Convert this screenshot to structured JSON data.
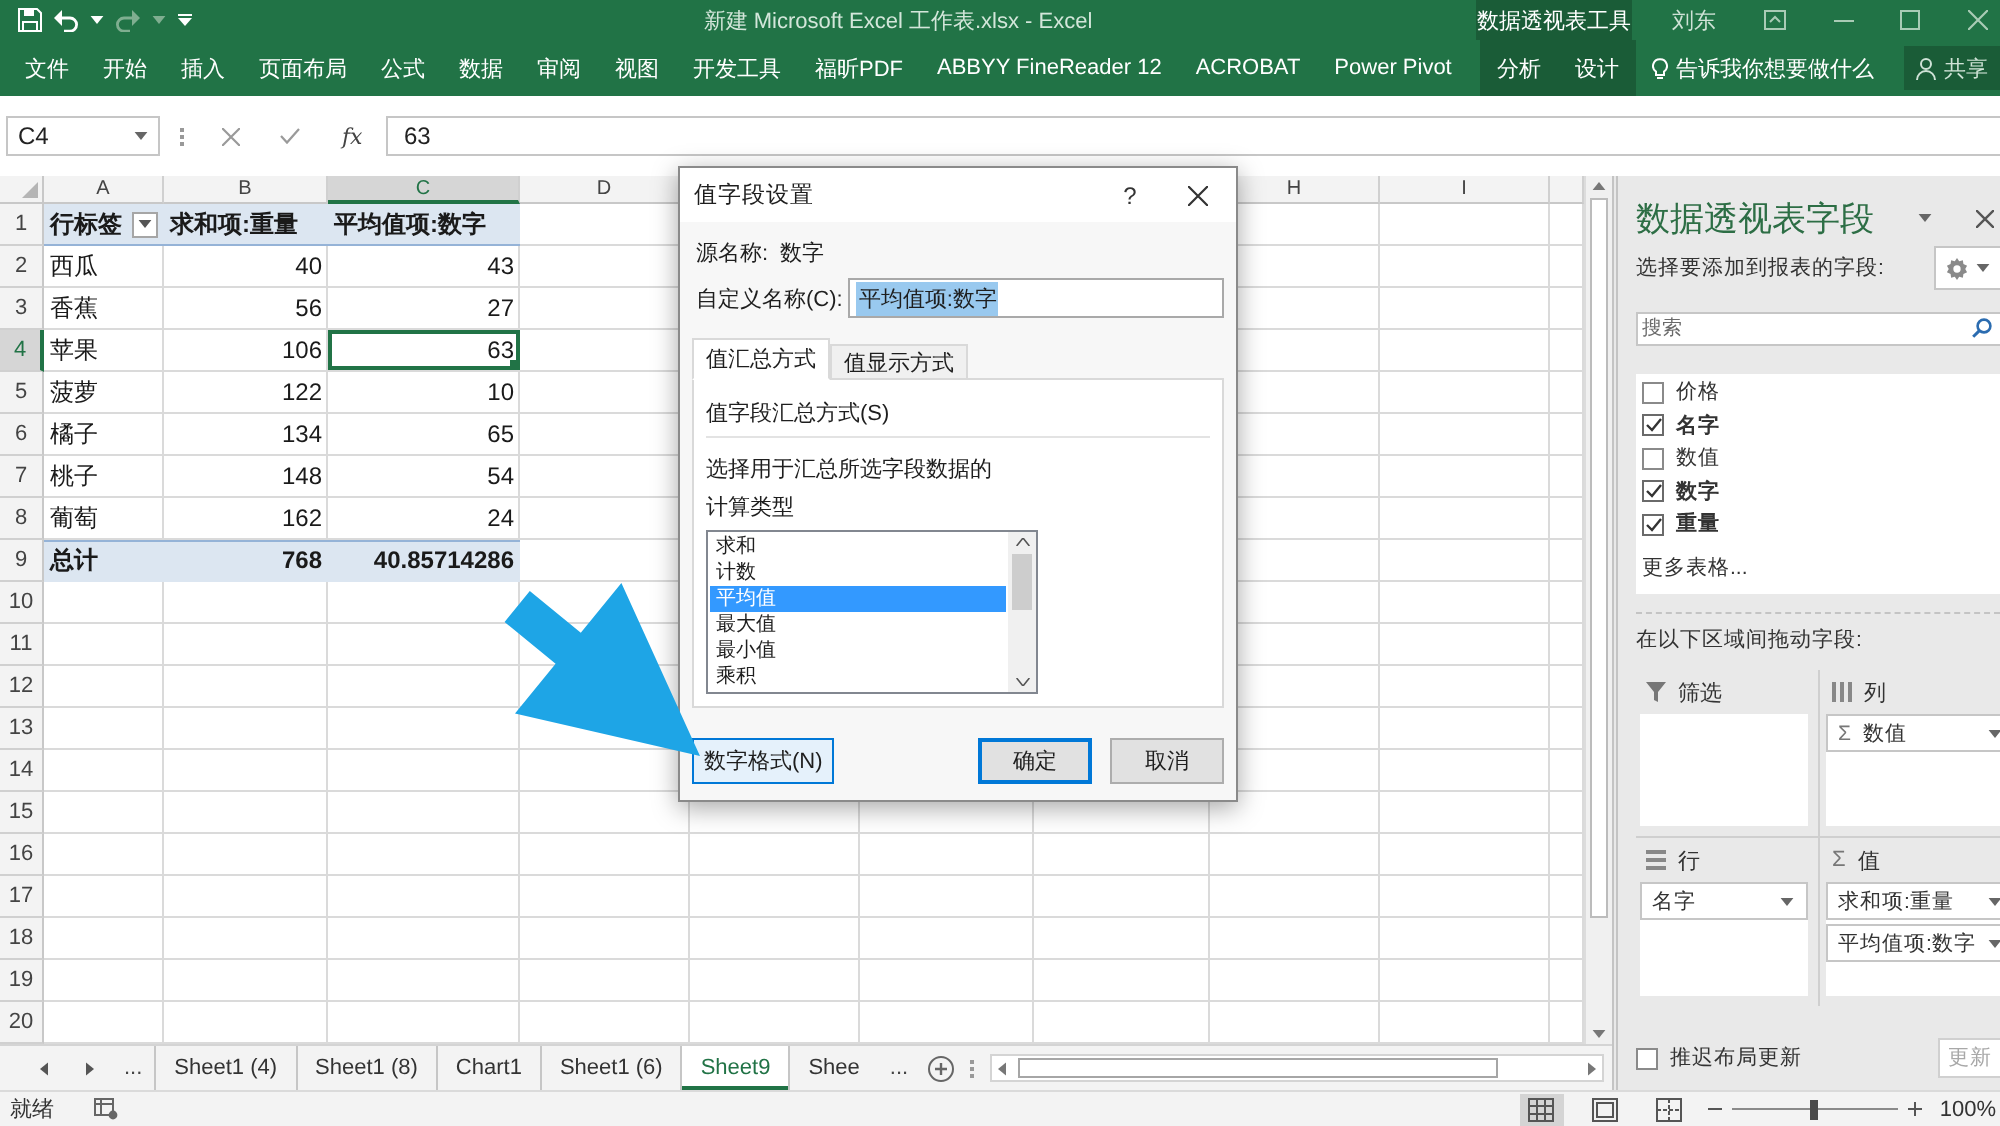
{
  "window": {
    "title": "新建 Microsoft Excel 工作表.xlsx - Excel",
    "user": "刘东"
  },
  "ribbon": {
    "tabs": [
      {
        "label": "文件",
        "selected": false
      },
      {
        "label": "开始",
        "selected": false
      },
      {
        "label": "插入",
        "selected": false
      },
      {
        "label": "页面布局",
        "selected": false
      },
      {
        "label": "公式",
        "selected": false
      },
      {
        "label": "数据",
        "selected": false
      },
      {
        "label": "审阅",
        "selected": false
      },
      {
        "label": "视图",
        "selected": false
      },
      {
        "label": "开发工具",
        "selected": false
      },
      {
        "label": "福昕PDF",
        "selected": false
      },
      {
        "label": "ABBYY FineReader 12",
        "selected": false
      },
      {
        "label": "ACROBAT",
        "selected": false
      },
      {
        "label": "Power Pivot",
        "selected": false
      }
    ],
    "context_group": {
      "label": "数据透视表工具",
      "tabs": [
        {
          "label": "分析",
          "selected": false
        },
        {
          "label": "设计",
          "selected": false
        }
      ]
    },
    "tell_me": "告诉我你想要做什么",
    "share": "共享"
  },
  "formula_bar": {
    "name_box": "C4",
    "function_label": "fx",
    "value": "63"
  },
  "sheet": {
    "columns": [
      {
        "label": "A",
        "selected": false
      },
      {
        "label": "B",
        "selected": false
      },
      {
        "label": "C",
        "selected": true
      },
      {
        "label": "D",
        "selected": false
      },
      {
        "label": "H",
        "selected": false
      },
      {
        "label": "I",
        "selected": false
      }
    ],
    "rows": [
      {
        "number": "1",
        "kind": "header",
        "selected": false,
        "cells": [
          "行标签",
          "求和项:重量",
          "平均值项:数字"
        ]
      },
      {
        "number": "2",
        "kind": "data",
        "selected": false,
        "cells": [
          "西瓜",
          "40",
          "43"
        ]
      },
      {
        "number": "3",
        "kind": "data",
        "selected": false,
        "cells": [
          "香蕉",
          "56",
          "27"
        ]
      },
      {
        "number": "4",
        "kind": "data",
        "selected": true,
        "cells": [
          "苹果",
          "106",
          "63"
        ]
      },
      {
        "number": "5",
        "kind": "data",
        "selected": false,
        "cells": [
          "菠萝",
          "122",
          "10"
        ]
      },
      {
        "number": "6",
        "kind": "data",
        "selected": false,
        "cells": [
          "橘子",
          "134",
          "65"
        ]
      },
      {
        "number": "7",
        "kind": "data",
        "selected": false,
        "cells": [
          "桃子",
          "148",
          "54"
        ]
      },
      {
        "number": "8",
        "kind": "data",
        "selected": false,
        "cells": [
          "葡萄",
          "162",
          "24"
        ]
      },
      {
        "number": "9",
        "kind": "total",
        "selected": false,
        "cells": [
          "总计",
          "768",
          "40.85714286"
        ]
      },
      {
        "number": "10",
        "kind": "empty",
        "selected": false
      },
      {
        "number": "11",
        "kind": "empty",
        "selected": false
      },
      {
        "number": "12",
        "kind": "empty",
        "selected": false
      },
      {
        "number": "13",
        "kind": "empty",
        "selected": false
      },
      {
        "number": "14",
        "kind": "empty",
        "selected": false
      },
      {
        "number": "15",
        "kind": "empty",
        "selected": false
      },
      {
        "number": "16",
        "kind": "empty",
        "selected": false
      },
      {
        "number": "17",
        "kind": "empty",
        "selected": false
      },
      {
        "number": "18",
        "kind": "empty",
        "selected": false
      },
      {
        "number": "19",
        "kind": "empty",
        "selected": false
      },
      {
        "number": "20",
        "kind": "empty",
        "selected": false
      }
    ]
  },
  "sheet_tabs": {
    "more_left": "...",
    "tabs": [
      {
        "label": "Sheet1 (4)",
        "selected": false
      },
      {
        "label": "Sheet1 (8)",
        "selected": false
      },
      {
        "label": "Chart1",
        "selected": false
      },
      {
        "label": "Sheet1 (6)",
        "selected": false
      },
      {
        "label": "Sheet9",
        "selected": true
      },
      {
        "label": "Shee",
        "selected": false
      }
    ],
    "more_right": "..."
  },
  "dialog": {
    "title": "值字段设置",
    "help": "?",
    "source_label": "源名称:",
    "source_value": "数字",
    "custom_name_label": "自定义名称(C):",
    "custom_name": "平均值项:数字",
    "custom_name_selected": true,
    "tabs": [
      {
        "label": "值汇总方式",
        "selected": true
      },
      {
        "label": "值显示方式",
        "selected": false
      }
    ],
    "section_title": "值字段汇总方式(S)",
    "description": "选择用于汇总所选字段数据的",
    "list_label": "计算类型",
    "functions": [
      {
        "label": "求和",
        "selected": false
      },
      {
        "label": "计数",
        "selected": false
      },
      {
        "label": "平均值",
        "selected": true
      },
      {
        "label": "最大值",
        "selected": false
      },
      {
        "label": "最小值",
        "selected": false
      },
      {
        "label": "乘积",
        "selected": false
      }
    ],
    "buttons": [
      {
        "label": "数字格式(N)",
        "kind": "focused"
      },
      {
        "label": "确定",
        "kind": "default"
      },
      {
        "label": "取消",
        "kind": "normal"
      }
    ]
  },
  "pivot_panel": {
    "title": "数据透视表字段",
    "prompt": "选择要添加到报表的字段:",
    "search": {
      "placeholder": "搜索"
    },
    "fields": [
      {
        "label": "价格",
        "checked": false
      },
      {
        "label": "名字",
        "checked": true
      },
      {
        "label": "数值",
        "checked": false
      },
      {
        "label": "数字",
        "checked": true
      },
      {
        "label": "重量",
        "checked": true
      }
    ],
    "more_tables": "更多表格...",
    "areas_prompt": "在以下区域间拖动字段:",
    "areas": [
      {
        "kind": "filters",
        "label": "筛选"
      },
      {
        "kind": "columns",
        "label": "列",
        "items": [
          {
            "symbol": "Σ",
            "label": "数值"
          }
        ]
      },
      {
        "kind": "rows",
        "label": "行",
        "items": [
          {
            "label": "名字"
          }
        ]
      },
      {
        "kind": "values",
        "symbol": "Σ",
        "label": "值",
        "items": [
          {
            "label": "求和项:重量"
          },
          {
            "label": "平均值项:数字"
          }
        ]
      }
    ],
    "defer_update": {
      "label": "推迟布局更新",
      "checked": false
    },
    "update_button": {
      "label": "更新",
      "disabled": true
    }
  },
  "status_bar": {
    "status": "就绪",
    "views": [
      {
        "kind": "normal",
        "selected": true
      },
      {
        "kind": "page_layout",
        "selected": false
      },
      {
        "kind": "page_break",
        "selected": false
      }
    ],
    "zoom": {
      "level": 0.5,
      "label": "100%"
    }
  }
}
